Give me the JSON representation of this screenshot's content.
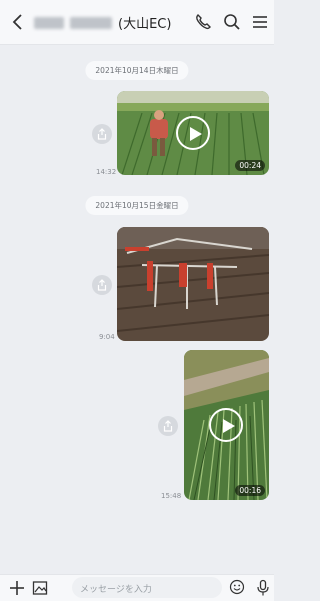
{
  "header": {
    "back_icon": "chevron-left-icon",
    "title_suffix": "(大山EC)",
    "call_icon": "phone-icon",
    "search_icon": "search-icon",
    "menu_icon": "hamburger-menu-icon"
  },
  "messages": [
    {
      "date": "2021年10月14日木曜日",
      "time": "14:32",
      "duration": "00:24",
      "type": "video"
    },
    {
      "date": "2021年10月15日金曜日",
      "time": "9:04",
      "type": "image"
    },
    {
      "time": "15:48",
      "duration": "00:16",
      "type": "video"
    }
  ],
  "footer": {
    "input_placeholder": "メッセージを入力",
    "plus_icon": "plus-icon",
    "image_icon": "image-icon",
    "emoji_icon": "emoji-icon",
    "mic_icon": "microphone-icon"
  }
}
